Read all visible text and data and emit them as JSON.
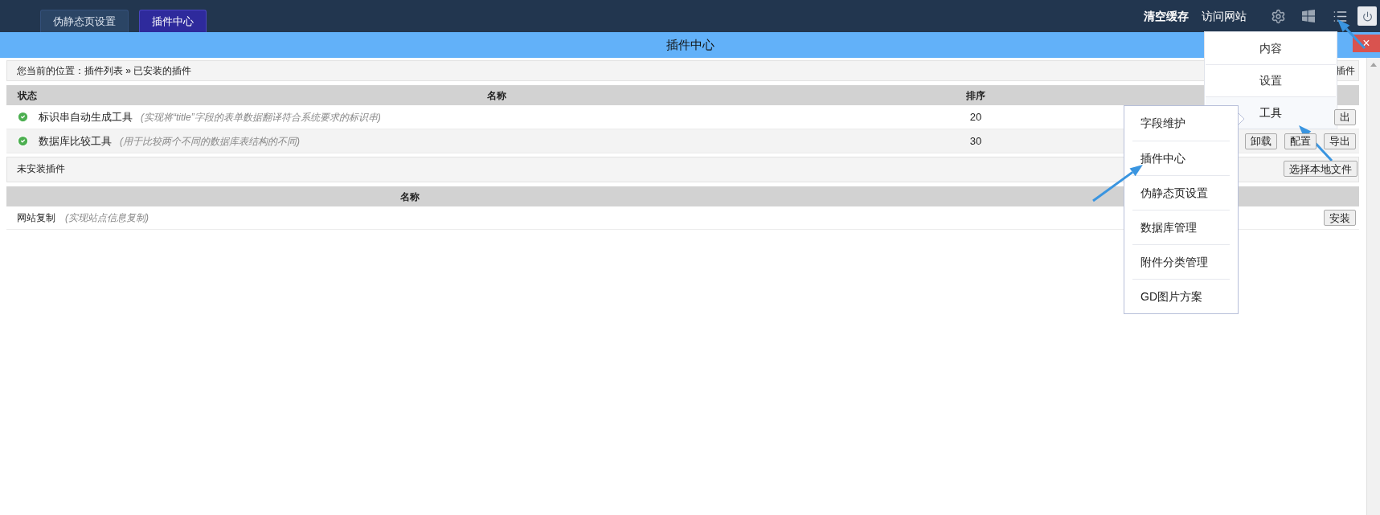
{
  "top_tabs": [
    {
      "label": "伪静态页设置",
      "selected": false
    },
    {
      "label": "插件中心",
      "selected": true
    }
  ],
  "top_links": [
    {
      "label": "清空缓存",
      "emphasized": true
    },
    {
      "label": "访问网站",
      "emphasized": false
    }
  ],
  "panel": {
    "title": "插件中心",
    "close": "×"
  },
  "breadcrumb": {
    "text": "您当前的位置：插件列表 » 已安装的插件",
    "action": "插件"
  },
  "installed": {
    "columns": [
      "状态",
      "名称",
      "排序"
    ],
    "rows": [
      {
        "enabled": true,
        "name": "标识串自动生成工具",
        "description": "(实现将“title”字段的表单数据翻译符合系统要求的标识串)",
        "order": "20",
        "actions": [
          "出"
        ]
      },
      {
        "enabled": true,
        "name": "数据库比较工具",
        "description": "(用于比较两个不同的数据库表结构的不同)",
        "order": "30",
        "actions": [
          "卸载",
          "配置",
          "导出"
        ]
      }
    ]
  },
  "uninstalled": {
    "title": "未安装插件",
    "upload_button": "选择本地文件",
    "columns": [
      "名称"
    ],
    "rows": [
      {
        "name": "网站复制",
        "description": "(实现站点信息复制)",
        "action": "安装"
      }
    ]
  },
  "menu": {
    "items": [
      {
        "label": "内容",
        "expanded": false
      },
      {
        "label": "设置",
        "expanded": false
      },
      {
        "label": "工具",
        "expanded": true
      }
    ]
  },
  "submenu": {
    "items": [
      "字段维护",
      "插件中心",
      "伪静态页设置",
      "数据库管理",
      "附件分类管理",
      "GD图片方案"
    ]
  }
}
